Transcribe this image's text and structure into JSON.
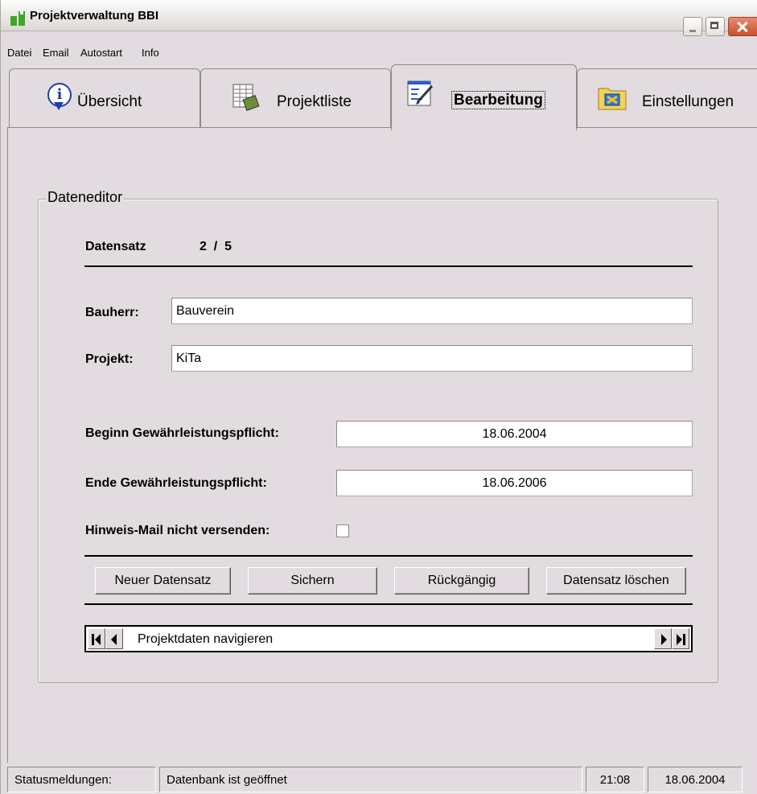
{
  "window": {
    "title": "Projektverwaltung BBI"
  },
  "menu": {
    "items": [
      "Datei",
      "Email",
      "Autostart",
      "Info"
    ]
  },
  "tabs": [
    {
      "label": "Übersicht",
      "icon": "info-icon"
    },
    {
      "label": "Projektliste",
      "icon": "list-icon"
    },
    {
      "label": "Bearbeitung",
      "icon": "edit-icon",
      "active": true
    },
    {
      "label": "Einstellungen",
      "icon": "settings-icon"
    }
  ],
  "editor": {
    "group_title": "Dateneditor",
    "record_label": "Datensatz",
    "record_position": "2  /  5",
    "bauherr_label": "Bauherr:",
    "bauherr_value": "Bauverein",
    "projekt_label": "Projekt:",
    "projekt_value": "KiTa",
    "beginn_label": "Beginn Gewährleistungspflicht:",
    "beginn_value": "18.06.2004",
    "ende_label": "Ende Gewährleistungspflicht:",
    "ende_value": "18.06.2006",
    "mail_label": "Hinweis-Mail nicht versenden:",
    "mail_checked": false,
    "buttons": {
      "new": "Neuer Datensatz",
      "save": "Sichern",
      "undo": "Rückgängig",
      "delete": "Datensatz löschen"
    },
    "navigator_text": "Projektdaten navigieren"
  },
  "status": {
    "label": "Statusmeldungen:",
    "message": "Datenbank ist geöffnet",
    "time": "21:08",
    "date": "18.06.2004"
  },
  "colors": {
    "window_bg": "#e2dce0",
    "accent_green": "#3aa82a",
    "close_red": "#c9502d"
  }
}
